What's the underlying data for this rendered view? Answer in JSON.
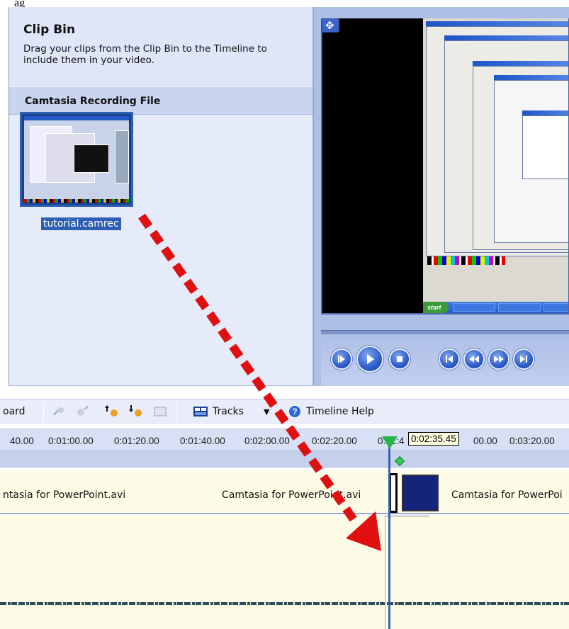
{
  "caption": "ag",
  "clip_bin": {
    "title": "Clip Bin",
    "description": "Drag your clips from the Clip Bin to the Timeline to include them in your video.",
    "section_title": "Camtasia Recording File",
    "clip_label": "tutorial.camrec"
  },
  "toolbar": {
    "storyboard_label": "oard",
    "tracks_label": "Tracks",
    "help_label": "Timeline Help"
  },
  "ruler": {
    "ticks": [
      "40.00",
      "0:01:00.00",
      "0:01:20.00",
      "0:01:40.00",
      "0:02:00.00",
      "0:02:20.00",
      "0:02:4",
      "00.00",
      "0:03:20.00"
    ]
  },
  "playhead": {
    "time": "0:02:35.45"
  },
  "video_track": {
    "clip1": "ntasia for PowerPoint.avi",
    "clip2": "Camtasia for PowerPoint.avi",
    "clip3": "Camtasia for PowerPoi"
  },
  "colors": {
    "accent": "#2d5fb4",
    "arrow": "#e01010",
    "playhead": "#26b54a"
  }
}
